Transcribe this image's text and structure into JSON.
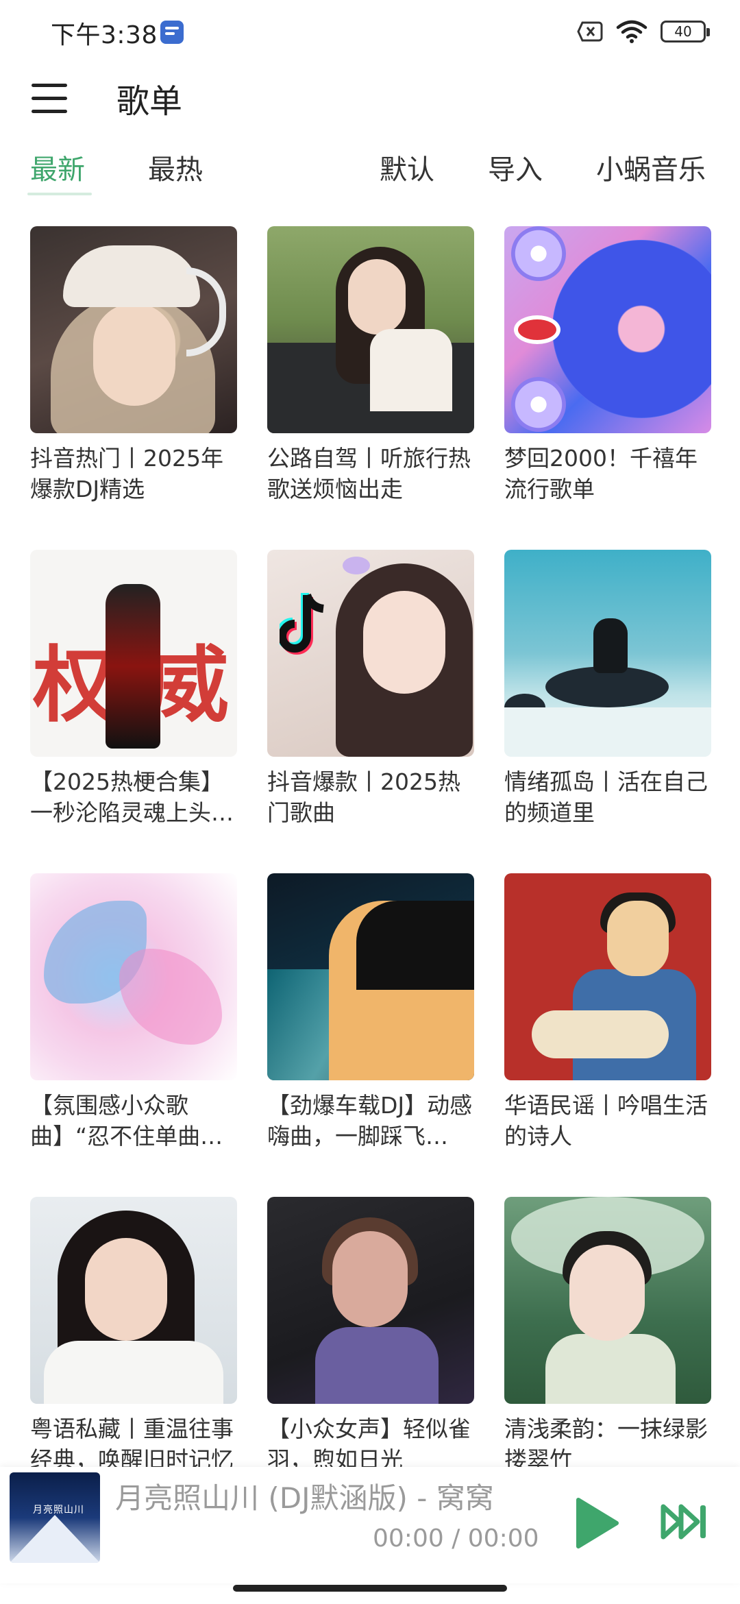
{
  "status_bar": {
    "time": "下午3:38",
    "battery": "40",
    "icons": [
      "music-app-icon",
      "sim-off-icon",
      "wifi-icon",
      "battery-icon"
    ]
  },
  "header": {
    "title": "歌单",
    "menu_icon": "menu-icon"
  },
  "tabs": [
    {
      "label": "最新",
      "active": true
    },
    {
      "label": "最热",
      "active": false
    },
    {
      "label": "默认",
      "active": false
    },
    {
      "label": "导入",
      "active": false
    },
    {
      "label": "小蜗音乐",
      "active": false
    }
  ],
  "playlists": [
    {
      "title": "抖音热门丨2025年爆款DJ精选"
    },
    {
      "title": "公路自驾丨听旅行热歌送烦恼出走"
    },
    {
      "title": "梦回2000！千禧年流行歌单"
    },
    {
      "title": "【2025热梗合集】一秒沦陷灵魂上头…"
    },
    {
      "title": "抖音爆款丨2025热门歌曲"
    },
    {
      "title": "情绪孤岛丨活在自己的频道里"
    },
    {
      "title": "【氛围感小众歌曲】“忍不住单曲循环！”"
    },
    {
      "title": "【劲爆车载DJ】动感嗨曲，一脚踩飞…"
    },
    {
      "title": "华语民谣丨吟唱生活的诗人"
    },
    {
      "title": "粤语私藏丨重温往事经典，唤醒旧时记忆"
    },
    {
      "title": "【小众女声】轻似雀羽，煦如日光"
    },
    {
      "title": "清浅柔韵：一抹绿影搂翠竹"
    }
  ],
  "player": {
    "song": "月亮照山川 (DJ默涵版) - 窝窝",
    "progress": "00:00 / 00:00",
    "cover_text": "月亮照山川",
    "accent": "#3fa66c"
  },
  "colors": {
    "accent": "#3fa66c",
    "tab_indicator": "#d5ecdf"
  }
}
